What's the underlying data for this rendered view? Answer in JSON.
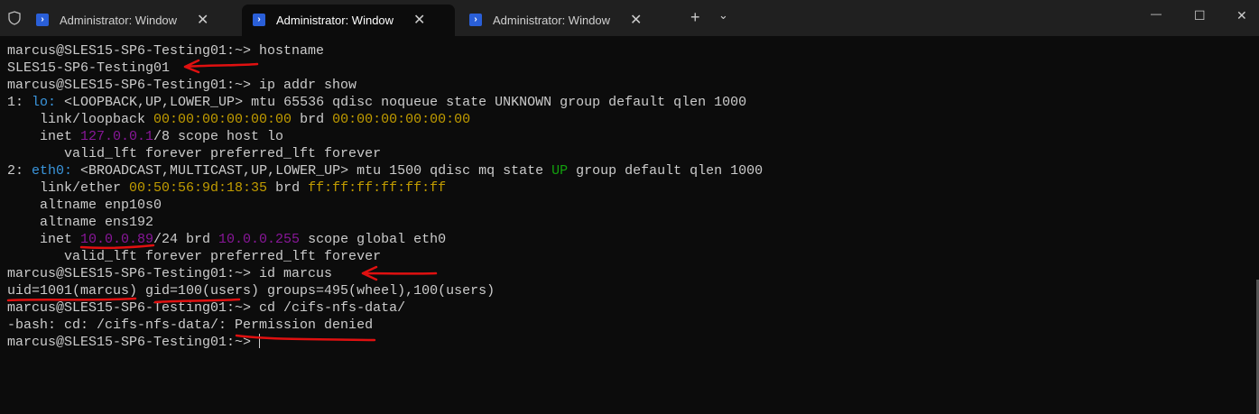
{
  "tabs": [
    {
      "title": "Administrator: Windows PowerShell",
      "active": false
    },
    {
      "title": "Administrator: Windows PowerShell",
      "active": true
    },
    {
      "title": "Administrator: Windows PowerShell",
      "active": false
    }
  ],
  "window_controls": {
    "new_tab": "+",
    "dropdown": "⌄",
    "minimize": "—",
    "maximize": "☐",
    "close": "✕"
  },
  "colors": {
    "blue": "#3a96dd",
    "yellow": "#c19c00",
    "purple": "#881798",
    "green": "#13a10e",
    "default": "#cccccc"
  },
  "lines": [
    [
      {
        "t": "marcus@SLES15-SP6-Testing01:~> hostname"
      }
    ],
    [
      {
        "t": "SLES15-SP6-Testing01"
      }
    ],
    [
      {
        "t": "marcus@SLES15-SP6-Testing01:~> ip addr show"
      }
    ],
    [
      {
        "t": "1: "
      },
      {
        "t": "lo:",
        "c": "blue"
      },
      {
        "t": " <LOOPBACK,UP,LOWER_UP> mtu 65536 qdisc noqueue state UNKNOWN group default qlen 1000"
      }
    ],
    [
      {
        "t": "    link/loopback "
      },
      {
        "t": "00:00:00:00:00:00",
        "c": "yellow"
      },
      {
        "t": " brd "
      },
      {
        "t": "00:00:00:00:00:00",
        "c": "yellow"
      }
    ],
    [
      {
        "t": "    inet "
      },
      {
        "t": "127.0.0.1",
        "c": "purple"
      },
      {
        "t": "/8 scope host lo"
      }
    ],
    [
      {
        "t": "       valid_lft forever preferred_lft forever"
      }
    ],
    [
      {
        "t": "2: "
      },
      {
        "t": "eth0:",
        "c": "blue"
      },
      {
        "t": " <BROADCAST,MULTICAST,UP,LOWER_UP> mtu 1500 qdisc mq state "
      },
      {
        "t": "UP",
        "c": "green"
      },
      {
        "t": " group default qlen 1000"
      }
    ],
    [
      {
        "t": "    link/ether "
      },
      {
        "t": "00:50:56:9d:18:35",
        "c": "yellow"
      },
      {
        "t": " brd "
      },
      {
        "t": "ff:ff:ff:ff:ff:ff",
        "c": "yellow"
      }
    ],
    [
      {
        "t": "    altname enp10s0"
      }
    ],
    [
      {
        "t": "    altname ens192"
      }
    ],
    [
      {
        "t": "    inet "
      },
      {
        "t": "10.0.0.89",
        "c": "purple"
      },
      {
        "t": "/24 brd "
      },
      {
        "t": "10.0.0.255",
        "c": "purple"
      },
      {
        "t": " scope global eth0"
      }
    ],
    [
      {
        "t": "       valid_lft forever preferred_lft forever"
      }
    ],
    [
      {
        "t": "marcus@SLES15-SP6-Testing01:~> id marcus"
      }
    ],
    [
      {
        "t": "uid=1001(marcus) gid=100(users) groups=495(wheel),100(users)"
      }
    ],
    [
      {
        "t": "marcus@SLES15-SP6-Testing01:~> cd /cifs-nfs-data/"
      }
    ],
    [
      {
        "t": "-bash: cd: /cifs-nfs-data/: Permission denied"
      }
    ],
    [
      {
        "t": "marcus@SLES15-SP6-Testing01:~> "
      }
    ]
  ]
}
